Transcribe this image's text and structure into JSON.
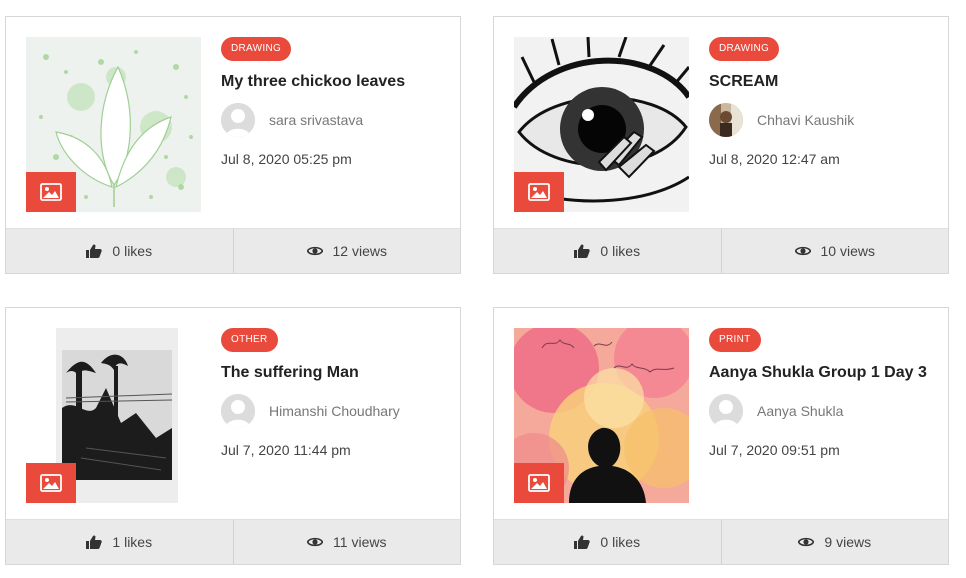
{
  "posts": [
    {
      "category": "DRAWING",
      "title": "My three chickoo leaves",
      "author": "sara srivastava",
      "date": "Jul 8, 2020 05:25 pm",
      "likes": "0 likes",
      "views": "12 views"
    },
    {
      "category": "DRAWING",
      "title": "SCREAM",
      "author": "Chhavi Kaushik",
      "date": "Jul 8, 2020 12:47 am",
      "likes": "0 likes",
      "views": "10 views"
    },
    {
      "category": "OTHER",
      "title": "The suffering Man",
      "author": "Himanshi Choudhary",
      "date": "Jul 7, 2020 11:44 pm",
      "likes": "1 likes",
      "views": "11 views"
    },
    {
      "category": "PRINT",
      "title": "Aanya Shukla Group 1 Day 3",
      "author": "Aanya Shukla",
      "date": "Jul 7, 2020 09:51 pm",
      "likes": "0 likes",
      "views": "9 views"
    }
  ],
  "colors": {
    "accent": "#e94a3b",
    "footer_bg": "#eaeaea"
  },
  "icons": {
    "image": "image-icon",
    "like": "thumbs-up-icon",
    "view": "eye-icon",
    "avatar": "user-avatar-icon"
  }
}
